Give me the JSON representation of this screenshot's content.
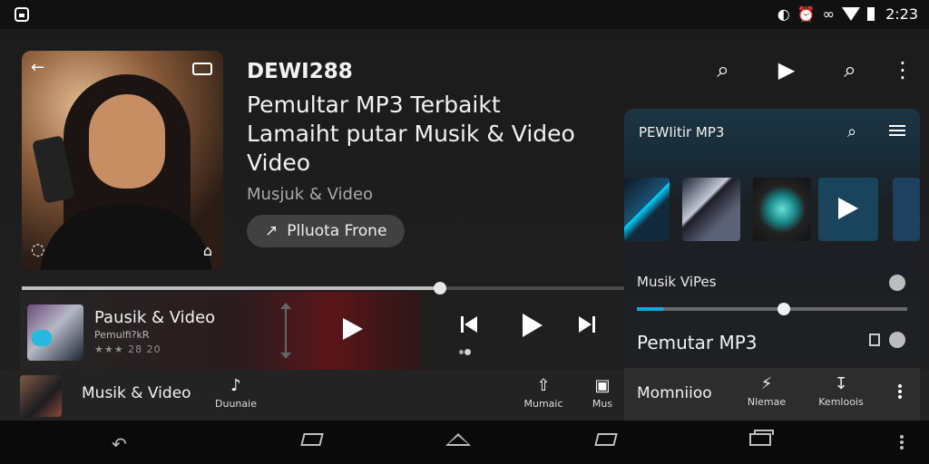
{
  "status": {
    "time": "2:23",
    "icons": [
      "sim-icon",
      "alarm-icon",
      "wifi-icon",
      "battery-icon"
    ]
  },
  "hero": {
    "brand": "DEWI288",
    "headline_lines": [
      "Pemultar MP3 Terbaikt",
      "Lamaiht putar Musik & Video",
      "Video"
    ],
    "subtitle": "Musjuk & Video",
    "promo_label": "Plluota Frone"
  },
  "seek": {
    "progress_pct": 69.5
  },
  "now_playing": {
    "title": "Pausik & Video",
    "subtitle": "Pemulfi?kR",
    "rating": "★★★ 28 20"
  },
  "transport": {
    "prev_label": "Previous",
    "play_label": "Play",
    "next_label": "Next"
  },
  "bottom_strip": {
    "title": "Musik & Video",
    "tabs": [
      {
        "label": "Duunaie",
        "icon": "music-note-icon"
      },
      {
        "label": "Mumaic",
        "icon": "arrow-up-icon"
      },
      {
        "label": "Mus",
        "icon": "image-icon"
      }
    ]
  },
  "right_panel": {
    "title": "PEWIitir MP3",
    "section1": "Musik ViPes",
    "section2": "Pemutar MP3",
    "slider_pct": 54.5,
    "bottom_title": "Momniioo",
    "tabs": [
      {
        "label": "Nlemae",
        "icon": "flash-icon"
      },
      {
        "label": "Kemloois",
        "icon": "download-icon"
      }
    ]
  },
  "nav": {
    "back": "back",
    "home": "home",
    "triangle": "triangle",
    "rect": "rect",
    "stack": "stack"
  },
  "colors": {
    "accent": "#19a6dd",
    "background": "#161616",
    "card_accent": "#5a1619"
  }
}
